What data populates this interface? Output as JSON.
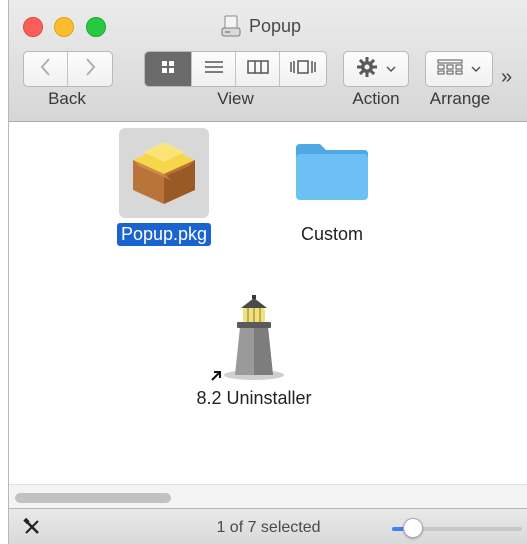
{
  "window": {
    "title": "Popup"
  },
  "toolbar": {
    "back_label": "Back",
    "view_label": "View",
    "action_label": "Action",
    "arrange_label": "Arrange",
    "overflow_glyph": "»"
  },
  "items": [
    {
      "name": "Popup.pkg",
      "icon": "package-icon",
      "selected": true
    },
    {
      "name": "Custom",
      "icon": "folder-icon",
      "selected": false
    },
    {
      "name": "8.2 Uninstaller",
      "icon": "lighthouse-alias-icon",
      "selected": false
    }
  ],
  "status": {
    "text": "1 of 7 selected",
    "icon_size_level": 0.16
  },
  "colors": {
    "selection": "#1a64d0",
    "folder": "#5db7ef",
    "accent": "#3b82f6"
  }
}
